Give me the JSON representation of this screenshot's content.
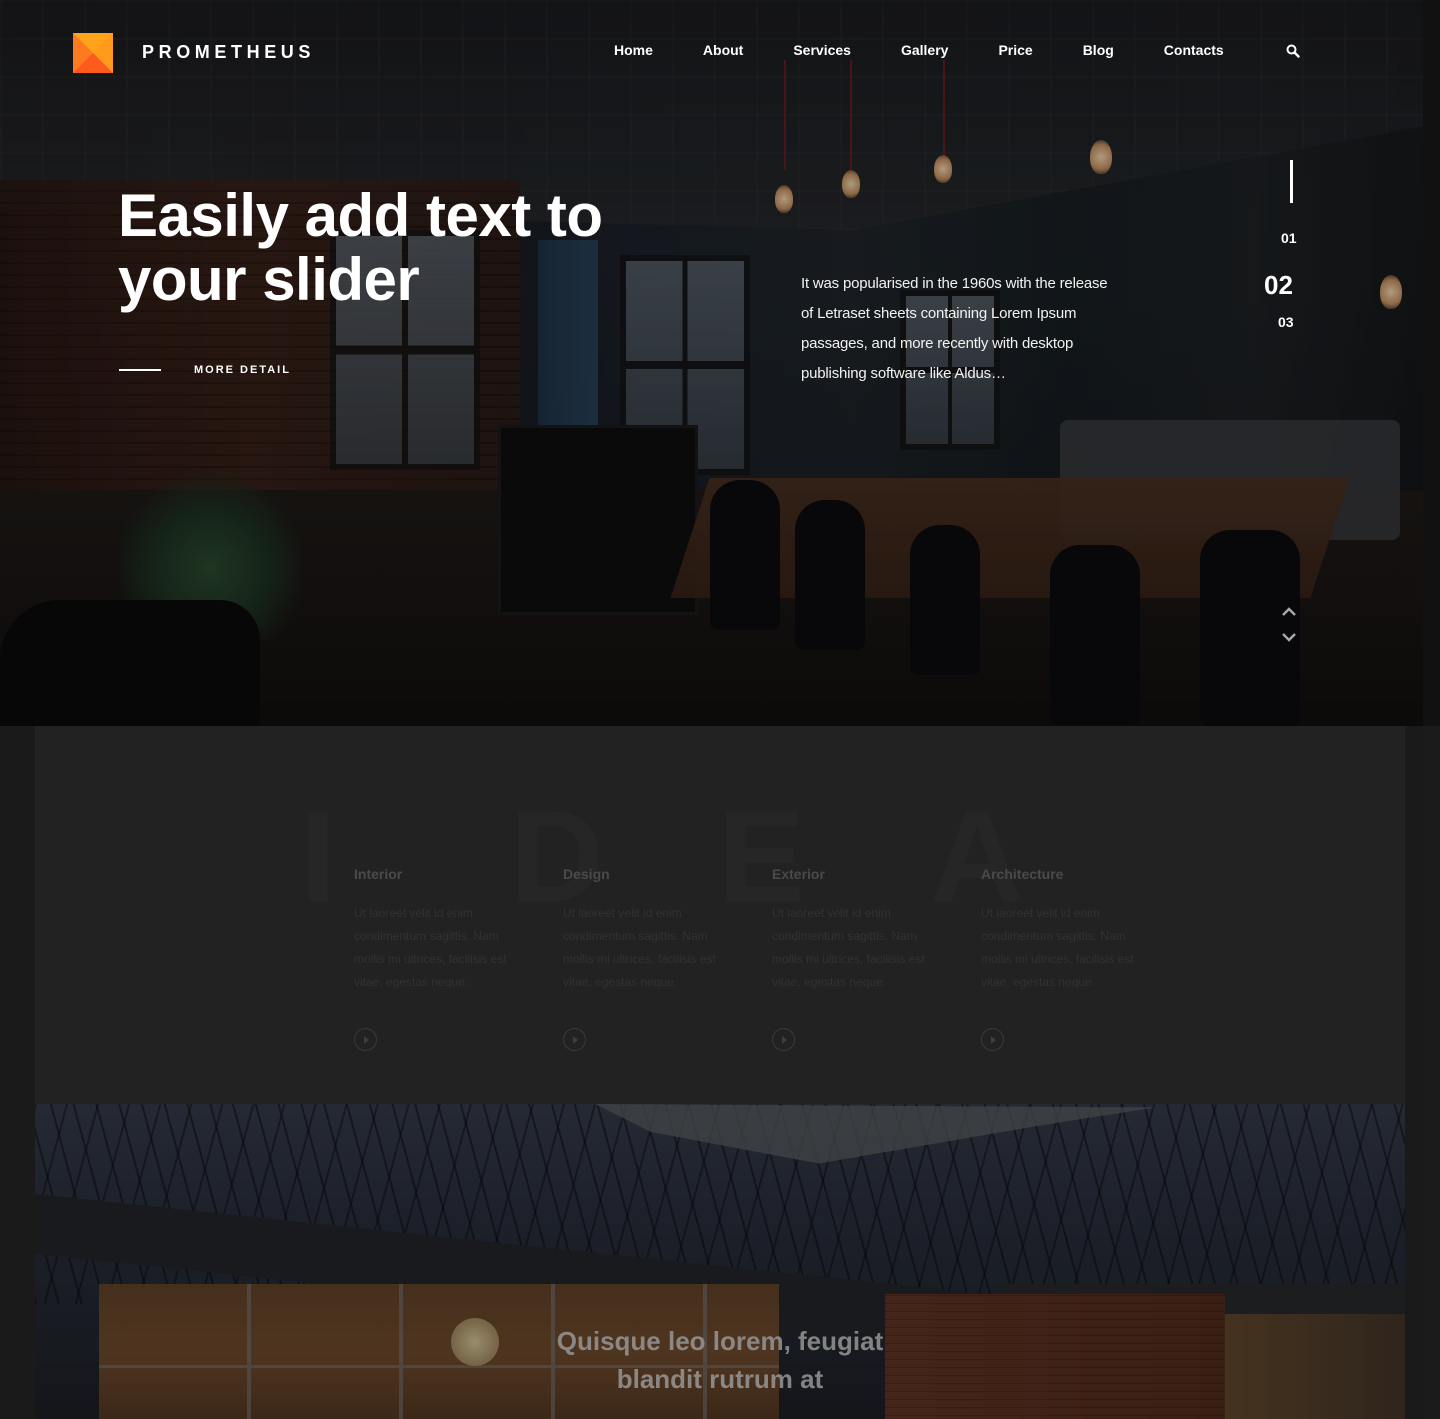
{
  "header": {
    "brand": "PROMETHEUS",
    "nav": [
      {
        "label": "Home"
      },
      {
        "label": "About"
      },
      {
        "label": "Services"
      },
      {
        "label": "Gallery"
      },
      {
        "label": "Price"
      },
      {
        "label": "Blog"
      },
      {
        "label": "Contacts"
      }
    ],
    "search_icon": "search-icon",
    "logo_colors": [
      "#ffa41a",
      "#ff9a1c",
      "#ff7a1f",
      "#ff5a1e"
    ]
  },
  "hero": {
    "title_line1": "Easily add text to",
    "title_line2": "your slider",
    "cta_label": "MORE DETAIL",
    "description": "It was popularised in the 1960s with the release of Letraset sheets containing Lorem Ipsum passages, and more recently with desktop publishing software like Aldus…",
    "slides": [
      "01",
      "02",
      "03"
    ],
    "active_slide": "02",
    "arrow_up_icon": "chevron-up-icon",
    "arrow_down_icon": "chevron-down-icon"
  },
  "idea": {
    "letters": [
      "I",
      "D",
      "E",
      "A"
    ],
    "features": [
      {
        "title": "Interior",
        "text": "Ut laoreet velit id enim condimentum sagittis. Nam mollis mi ultrices, facilisis est vitae, egestas neque.",
        "icon": "play-icon"
      },
      {
        "title": "Design",
        "text": "Ut laoreet velit id enim condimentum sagittis. Nam mollis mi ultrices, facilisis est vitae, egestas neque.",
        "icon": "play-icon"
      },
      {
        "title": "Exterior",
        "text": "Ut laoreet velit id enim condimentum sagittis. Nam mollis mi ultrices, facilisis est vitae, egestas neque.",
        "icon": "play-icon"
      },
      {
        "title": "Architecture",
        "text": "Ut laoreet velit id enim condimentum sagittis. Nam mollis mi ultrices, facilisis est vitae, egestas neque.",
        "icon": "play-icon"
      }
    ]
  },
  "house": {
    "quote_line1": "Quisque leo lorem, feugiat",
    "quote_line2": "blandit rutrum at"
  }
}
